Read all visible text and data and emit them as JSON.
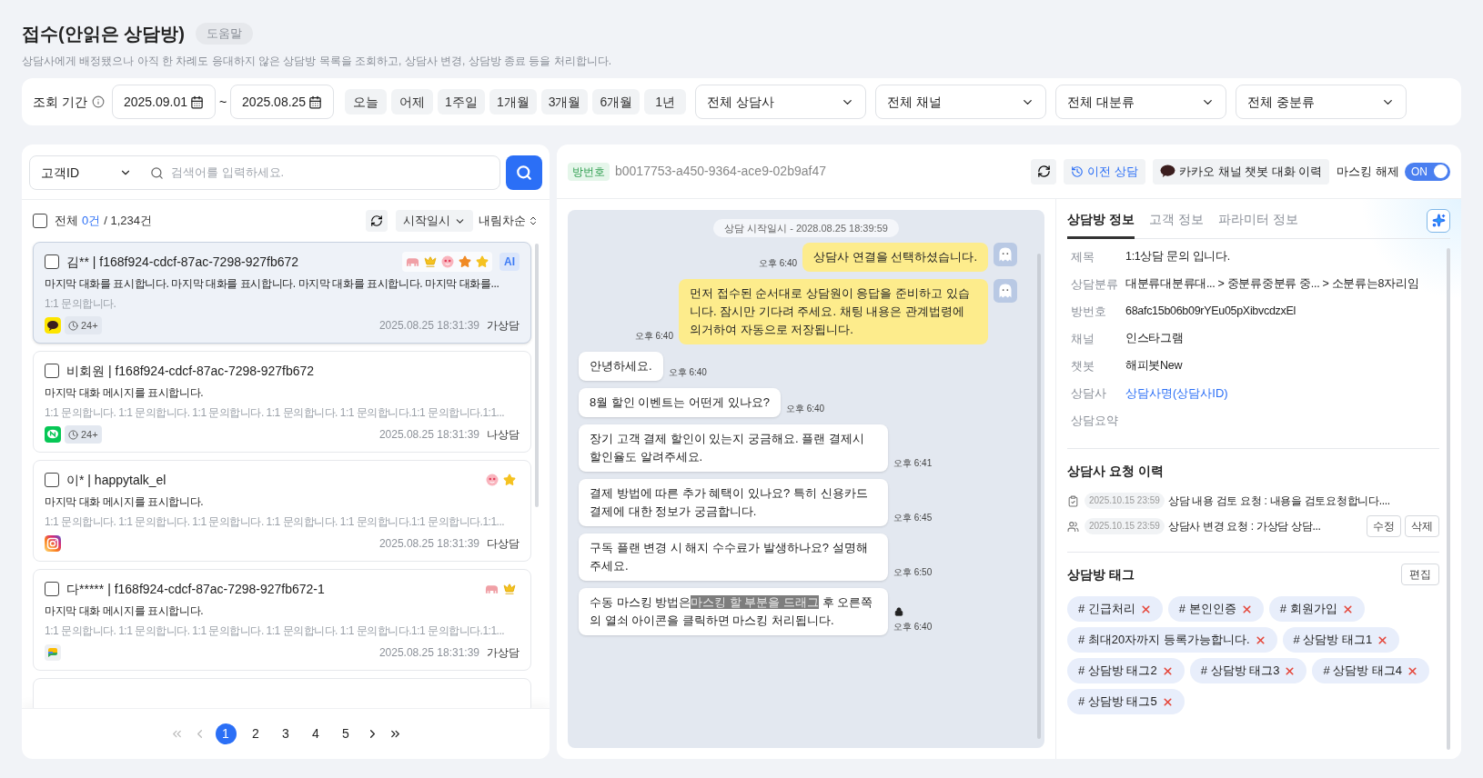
{
  "header": {
    "title": "접수(안읽은 상담방)",
    "help_button": "도움말",
    "description": "상담사에게 배정됐으나 아직 한 차례도 응대하지 않은 상담방 목록을 조회하고, 상담사 변경, 상담방 종료 등을 처리합니다."
  },
  "filters": {
    "period_label": "조회 기간",
    "date_from": "2025.09.01",
    "separator": "~",
    "date_to": "2025.08.25",
    "quick_ranges": [
      "오늘",
      "어제",
      "1주일",
      "1개월",
      "3개월",
      "6개월",
      "1년"
    ],
    "dropdowns": [
      "전체 상담사",
      "전체 채널",
      "전체 대분류",
      "전체 중분류"
    ]
  },
  "search": {
    "field_select": "고객ID",
    "placeholder": "검색어를 입력하세요."
  },
  "list_header": {
    "select_all_checked": false,
    "all_label": "전체",
    "selected_count": "0건",
    "total": "/ 1,234건",
    "sort_field": "시작일시",
    "sort_order": "내림차순"
  },
  "rooms": [
    {
      "checked": false,
      "selected": true,
      "title": "김** | f168f924-cdcf-87ac-7298-927fb672",
      "markers": [
        {
          "kind": "elephant"
        },
        {
          "kind": "crown"
        },
        {
          "kind": "face"
        },
        {
          "kind": "star",
          "color": "#f08a24"
        },
        {
          "kind": "star",
          "color": "#f5c220"
        }
      ],
      "ai_badge": "AI",
      "last_message": "마지막 대화를 표시합니다.  마지막 대화를 표시합니다. 마지막 대화를 표시합니다. 마지막 대화를...",
      "inquiry": "1:1 문의합니다.",
      "channel": {
        "kind": "kakao"
      },
      "wait_badge": "24+",
      "time": "2025.08.25 18:31:39",
      "counselor": "가상담"
    },
    {
      "checked": false,
      "selected": false,
      "title": "비회원 | f168f924-cdcf-87ac-7298-927fb672",
      "last_message": "마지막 대화 메시지를 표시합니다.",
      "inquiry": "1:1 문의합니다. 1:1 문의합니다. 1:1 문의합니다. 1:1 문의합니다. 1:1 문의합니다.1:1 문의합니다.1:1...",
      "channel": {
        "kind": "line"
      },
      "wait_badge": "24+",
      "time": "2025.08.25 18:31:39",
      "counselor": "나상담"
    },
    {
      "checked": false,
      "selected": false,
      "title": "이* | happytalk_el",
      "markers": [
        {
          "kind": "face"
        },
        {
          "kind": "star",
          "color": "#f5c220"
        }
      ],
      "last_message": "마지막 대화 메시지를 표시합니다.",
      "inquiry": "1:1 문의합니다. 1:1 문의합니다. 1:1 문의합니다. 1:1 문의합니다. 1:1 문의합니다.1:1 문의합니다.1:1...",
      "channel": {
        "kind": "instagram"
      },
      "time": "2025.08.25 18:31:39",
      "counselor": "다상담"
    },
    {
      "checked": false,
      "selected": false,
      "title": "다***** | f168f924-cdcf-87ac-7298-927fb672-1",
      "markers": [
        {
          "kind": "elephant"
        },
        {
          "kind": "crown"
        }
      ],
      "last_message": "마지막 대화 메시지를 표시합니다.",
      "inquiry": "1:1 문의합니다. 1:1 문의합니다. 1:1 문의합니다. 1:1 문의합니다. 1:1 문의합니다.1:1 문의합니다.1:1...",
      "channel": {
        "kind": "chat"
      },
      "time": "2025.08.25 18:31:39",
      "counselor": "가상담"
    }
  ],
  "pagination": [
    {
      "label": "1",
      "selected": true
    },
    {
      "label": "2",
      "selected": false
    },
    {
      "label": "3",
      "selected": false
    },
    {
      "label": "4",
      "selected": false
    },
    {
      "label": "5",
      "selected": false
    }
  ],
  "room_header": {
    "label": "방번호",
    "id": "b0017753-a450-9364-ace9-02b9af47",
    "previous_button": "이전 상담",
    "kakao_history_button": "카카오 채널 챗봇 대화 이력",
    "masking": {
      "label": "마스킹 해제",
      "on": true,
      "state_text": "ON"
    }
  },
  "chat": {
    "start_label": "상담 시작일시 - 2028.08.25 18:39:59",
    "messages": [
      {
        "kind": "bot",
        "segments": [
          {
            "text": "상담사 연결을 선택하셨습니다.",
            "highlighted": false
          }
        ],
        "time": "오후 6:40",
        "locked": false
      },
      {
        "kind": "bot",
        "segments": [
          {
            "text": "먼저 접수된 순서대로 상담원이 응답을 준비하고 있습니다. 잠시만 기다려 주세요. 채팅 내용은 관계법령에 의거하여 자동으로 저장됩니다.",
            "highlighted": false
          }
        ],
        "time": "오후 6:40",
        "locked": false
      },
      {
        "kind": "customer",
        "segments": [
          {
            "text": "안녕하세요.",
            "highlighted": false
          }
        ],
        "time": "오후 6:40",
        "locked": false
      },
      {
        "kind": "customer",
        "segments": [
          {
            "text": "8월 할인 이벤트는 어떤게 있나요?",
            "highlighted": false
          }
        ],
        "time": "오후 6:40",
        "locked": false
      },
      {
        "kind": "customer",
        "segments": [
          {
            "text": "장기 고객 결제 할인이 있는지 궁금해요. 플랜 결제시 할인율도 알려주세요.",
            "highlighted": false
          }
        ],
        "time": "오후 6:41",
        "locked": false
      },
      {
        "kind": "customer",
        "segments": [
          {
            "text": "결제 방법에 따른 추가 혜택이 있나요? 특히 신용카드 결제에 대한 정보가 궁금합니다.",
            "highlighted": false
          }
        ],
        "time": "오후 6:45",
        "locked": false
      },
      {
        "kind": "customer",
        "segments": [
          {
            "text": "구독 플랜 변경 시 해지 수수료가 발생하나요? 설명해 주세요.",
            "highlighted": false
          }
        ],
        "time": "오후 6:50",
        "locked": false
      },
      {
        "kind": "customer",
        "segments": [
          {
            "text": "수동 마스킹 방법은",
            "highlighted": false
          },
          {
            "text": "마스킹 할 부분을 드래그",
            "highlighted": true
          },
          {
            "text": " 후 오른쪽의 열쇠 아이콘을 클릭하면 마스킹 처리됩니다.",
            "highlighted": false
          }
        ],
        "time": "오후 6:40",
        "locked": true
      }
    ]
  },
  "details": {
    "tabs": [
      {
        "label": "상담방 정보",
        "selected": true
      },
      {
        "label": "고객 정보",
        "selected": false
      },
      {
        "label": "파라미터 정보",
        "selected": false
      }
    ],
    "info": [
      {
        "label": "제목",
        "value": "1:1상담 문의 입니다.",
        "kind": "text"
      },
      {
        "label": "상담분류",
        "value": "대분류대분류대...  > 중분류중분류 중... > 소분류는8자리임",
        "kind": "text"
      },
      {
        "label": "방번호",
        "value": "68afc15b06b09rYEu05pXibvcdzxEl",
        "kind": "text"
      },
      {
        "label": "채널",
        "value": "인스타그램",
        "kind": "text"
      },
      {
        "label": "챗봇",
        "value": "해피봇New",
        "kind": "text"
      },
      {
        "label": "상담사",
        "value": "상담사명(상담사ID)",
        "kind": "link"
      },
      {
        "label": "상담요약",
        "kind": "text"
      }
    ],
    "requests": {
      "title": "상담사 요청 이력",
      "items": [
        {
          "kind": "review",
          "date": "2025.10.15 23:59",
          "text": "상담 내용 검토 요청 : 내용을 검토요청합니다...."
        },
        {
          "kind": "transfer",
          "date": "2025.10.15 23:59",
          "text": "상담사 변경 요청 : 가상담 상담...",
          "actions": [
            "수정",
            "삭제"
          ]
        }
      ]
    },
    "tags": {
      "title": "상담방 태그",
      "edit_button": "편집",
      "items": [
        "# 긴급처리",
        "# 본인인증",
        "# 회원가입",
        "# 최대20자까지 등록가능합니다.",
        "# 상담방 태그1",
        "# 상담방 태그2",
        "# 상담방 태그3",
        "# 상담방 태그4",
        "# 상담방 태그5"
      ]
    }
  }
}
